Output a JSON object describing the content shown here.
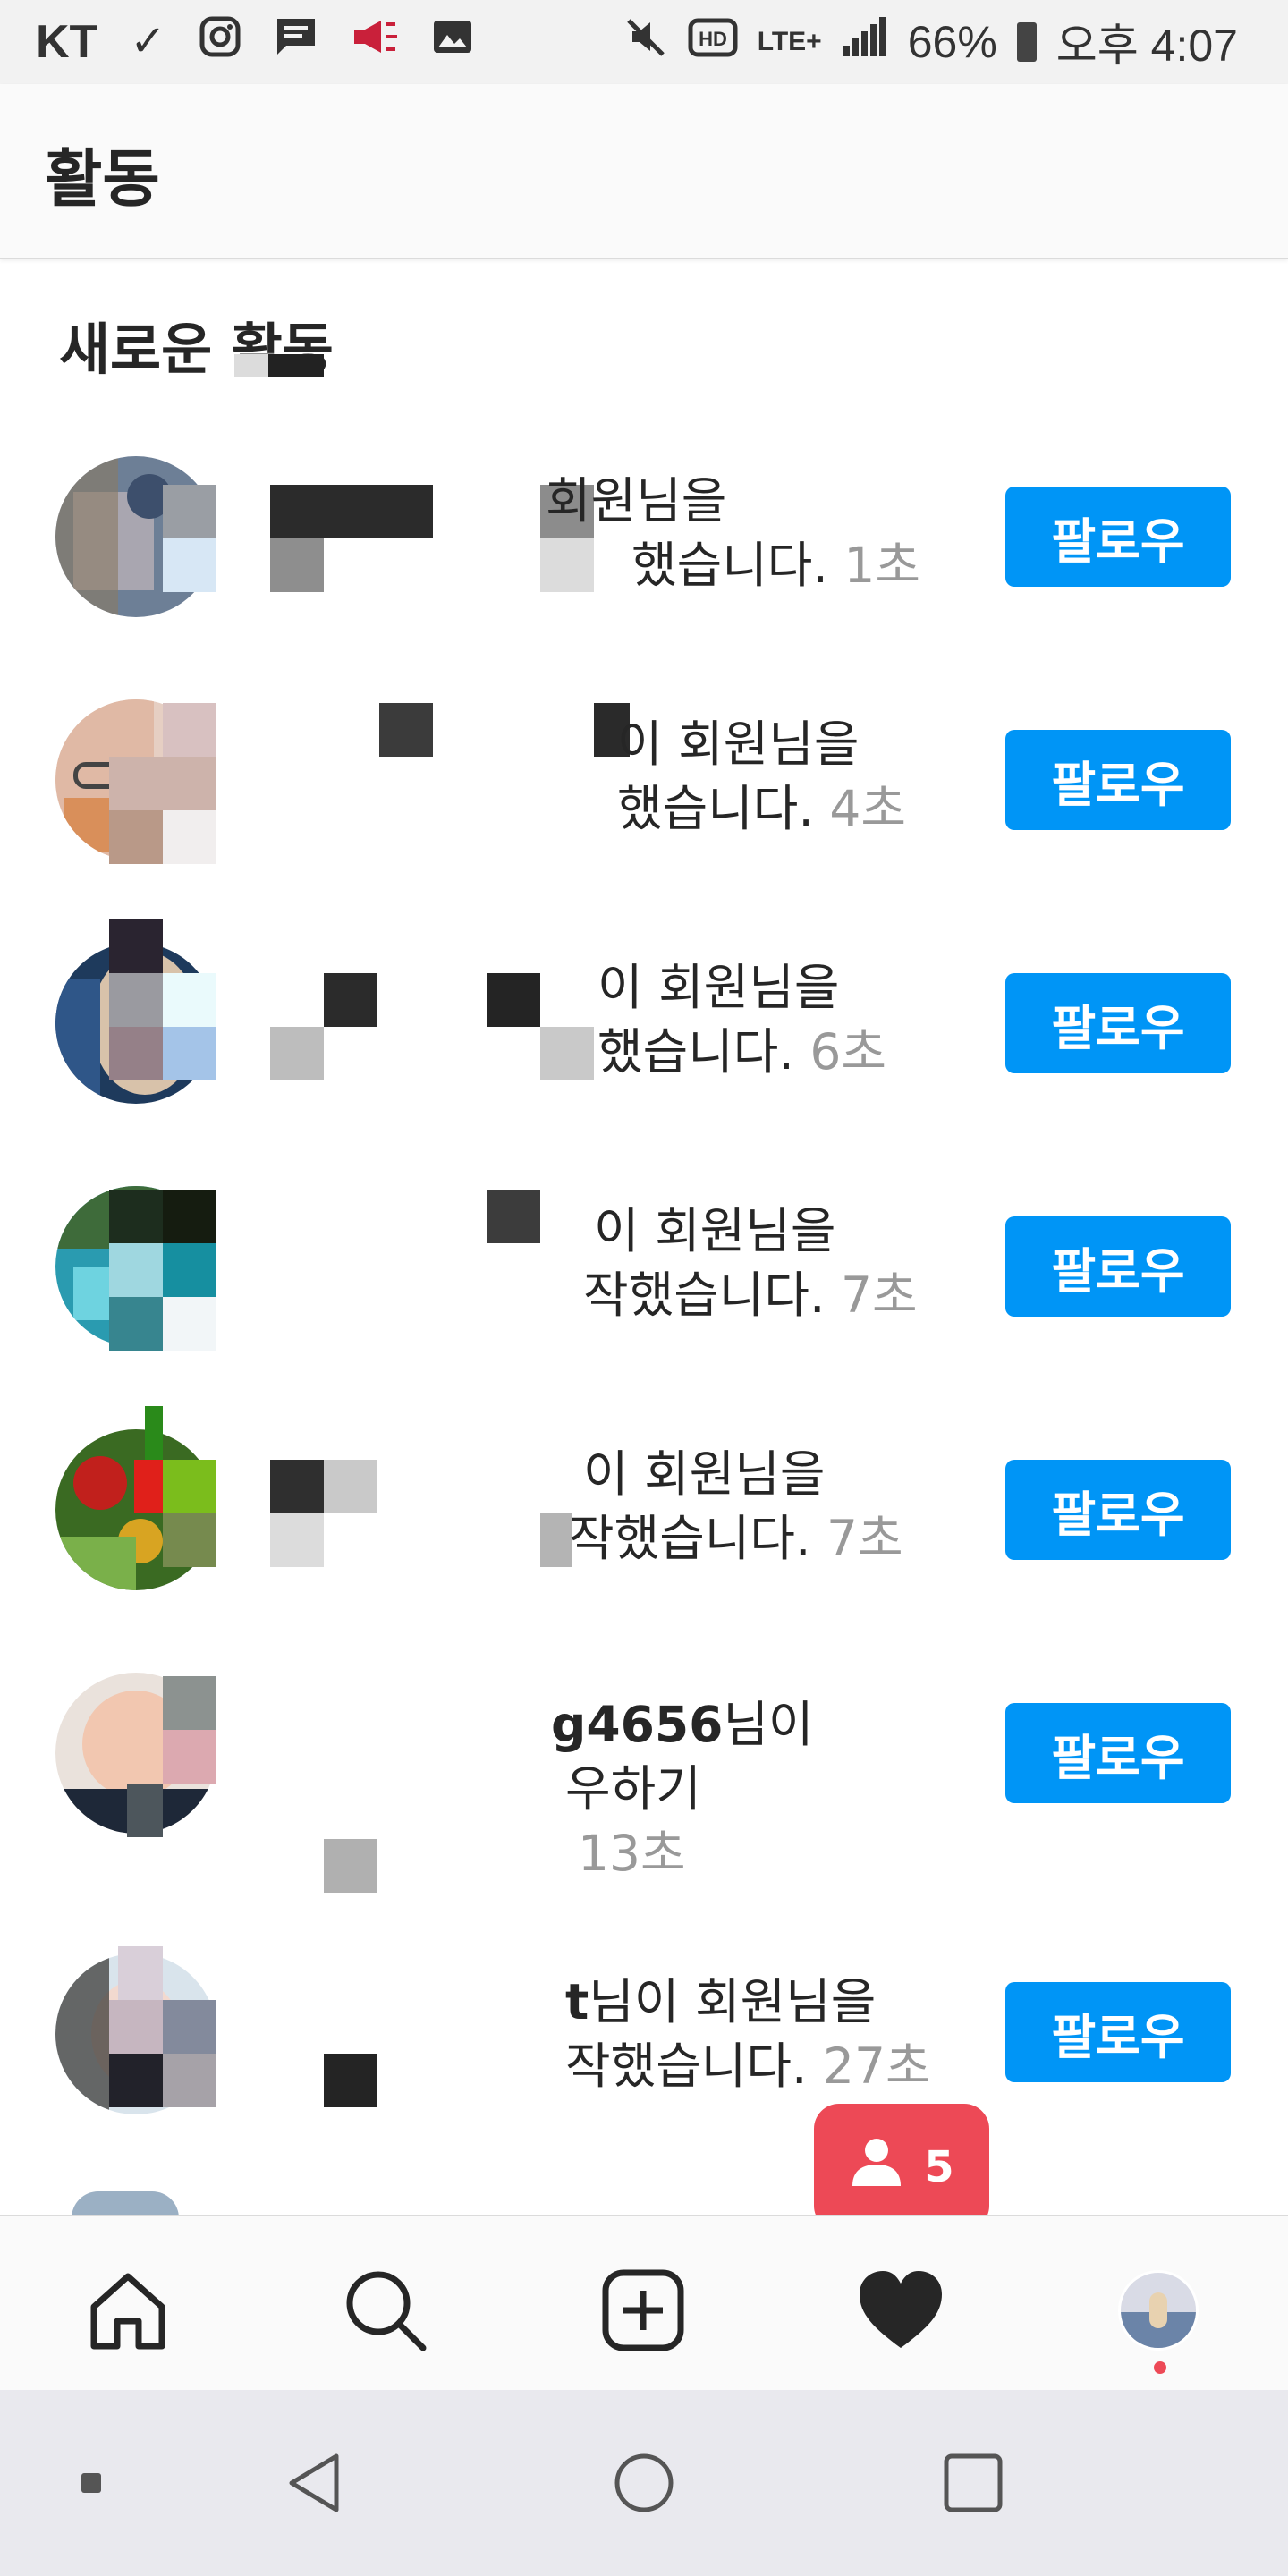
{
  "status_bar": {
    "carrier": "KT",
    "network": "LTE+",
    "battery": "66%",
    "time": "오후 4:07",
    "icons": [
      "check-icon",
      "instagram-icon",
      "message-icon",
      "megaphone-icon",
      "image-icon",
      "mute-icon",
      "hd-icon",
      "lte-icon",
      "signal-icon",
      "battery-icon"
    ]
  },
  "header": {
    "title": "활동"
  },
  "section": {
    "title": "새로운 활동"
  },
  "activities": [
    {
      "line1": "회원님을",
      "line2_text": "했습니다.",
      "time": "1초",
      "button": "팔로우"
    },
    {
      "line1": "이 회원님을",
      "line2_text": "했습니다.",
      "time": "4초",
      "button": "팔로우"
    },
    {
      "line1": "이 회원님을",
      "line2_text": "했습니다.",
      "time": "6초",
      "button": "팔로우"
    },
    {
      "line1": "이 회원님을",
      "line2_text": "작했습니다.",
      "time": "7초",
      "button": "팔로우"
    },
    {
      "line1": "이 회원님을",
      "line2_text": "작했습니다.",
      "time": "7초",
      "button": "팔로우"
    },
    {
      "line1_bold": "g4656",
      "line1": "님이",
      "line2_text": "우하기",
      "time": "13초",
      "button": "팔로우"
    },
    {
      "line1_bold": "t",
      "line1": "님이 회원님을",
      "line2_text": "작했습니다.",
      "time": "27초",
      "button": "팔로우"
    }
  ],
  "notification": {
    "icon": "person-icon",
    "count": "5",
    "color": "#ed4956"
  },
  "bottom_nav": {
    "items": [
      "home-icon",
      "search-icon",
      "add-post-icon",
      "heart-icon",
      "profile-avatar"
    ],
    "active": "heart-icon"
  },
  "colors": {
    "accent": "#0095f6",
    "badge": "#ed4956",
    "timestamp": "#999999"
  },
  "system_nav": [
    "recent-apps-icon",
    "back-icon",
    "home-circle-icon",
    "overview-icon"
  ]
}
